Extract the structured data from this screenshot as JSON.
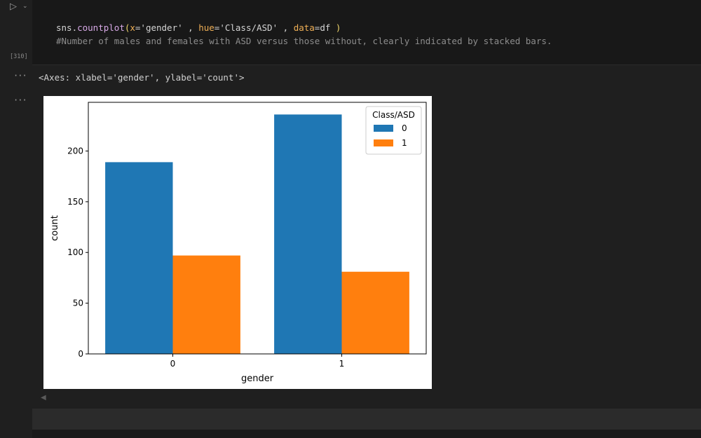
{
  "cell": {
    "execution_count": "[310]",
    "run_icon": "play-icon",
    "collapse_icon": "chevron-down-icon",
    "code": {
      "line1": {
        "p1": "sns.",
        "p2": "countplot",
        "p3": "(",
        "p4": "x",
        "p5": "='gender' , ",
        "p6": "hue",
        "p7": "='Class/ASD' , ",
        "p8": "data",
        "p9": "=df ",
        "p10": ")"
      },
      "line2": "#Number of males and females with ASD versus those without, clearly indicated by stacked bars."
    },
    "output_text": "<Axes: xlabel='gender', ylabel='count'>",
    "output_dots_1": "···",
    "output_dots_2": "···"
  },
  "chart_data": {
    "type": "bar",
    "categories": [
      "0",
      "1"
    ],
    "series": [
      {
        "name": "0",
        "values": [
          189,
          236
        ],
        "color": "#1f77b4"
      },
      {
        "name": "1",
        "values": [
          97,
          81
        ],
        "color": "#ff7f0e"
      }
    ],
    "xlabel": "gender",
    "ylabel": "count",
    "ylim": [
      0,
      248
    ],
    "yticks": [
      0,
      50,
      100,
      150,
      200
    ],
    "legend_title": "Class/ASD",
    "legend_position": "top-right",
    "grid": false
  }
}
